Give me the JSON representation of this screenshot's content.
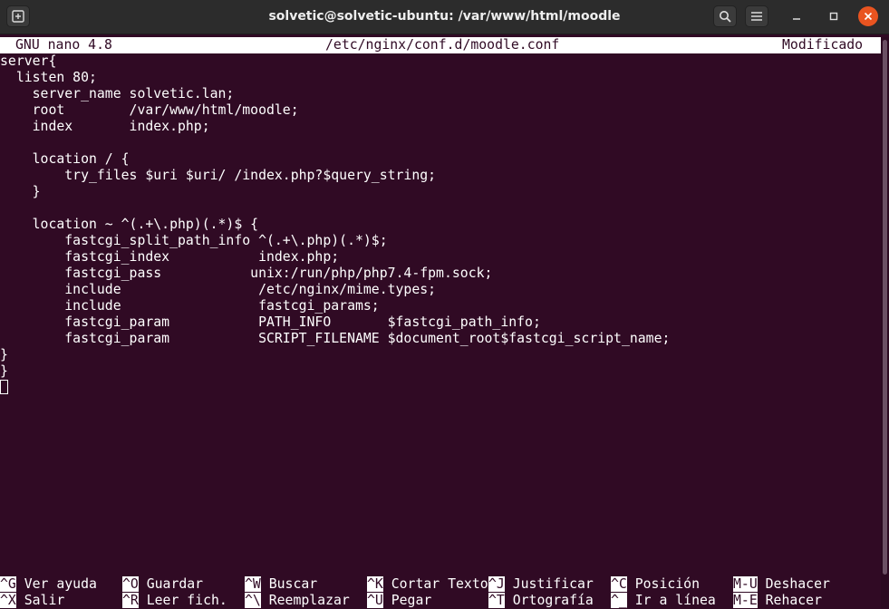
{
  "window": {
    "title": "solvetic@solvetic-ubuntu: /var/www/html/moodle"
  },
  "nano": {
    "version": "GNU nano 4.8",
    "filename": "/etc/nginx/conf.d/moodle.conf",
    "status": "Modificado"
  },
  "editor": {
    "lines": [
      "server{",
      "  listen 80;",
      "    server_name solvetic.lan;",
      "    root        /var/www/html/moodle;",
      "    index       index.php;",
      "",
      "    location / {",
      "        try_files $uri $uri/ /index.php?$query_string;",
      "    }",
      "",
      "    location ~ ^(.+\\.php)(.*)$ {",
      "        fastcgi_split_path_info ^(.+\\.php)(.*)$;",
      "        fastcgi_index           index.php;",
      "        fastcgi_pass           unix:/run/php/php7.4-fpm.sock;",
      "        include                 /etc/nginx/mime.types;",
      "        include                 fastcgi_params;",
      "        fastcgi_param           PATH_INFO       $fastcgi_path_info;",
      "        fastcgi_param           SCRIPT_FILENAME $document_root$fastcgi_script_name;",
      "}",
      "}"
    ]
  },
  "shortcuts": {
    "row1": [
      {
        "key": "^G",
        "label": "Ver ayuda"
      },
      {
        "key": "^O",
        "label": "Guardar"
      },
      {
        "key": "^W",
        "label": "Buscar"
      },
      {
        "key": "^K",
        "label": "Cortar Texto"
      },
      {
        "key": "^J",
        "label": "Justificar"
      },
      {
        "key": "^C",
        "label": "Posición"
      },
      {
        "key": "M-U",
        "label": "Deshacer"
      }
    ],
    "row2": [
      {
        "key": "^X",
        "label": "Salir"
      },
      {
        "key": "^R",
        "label": "Leer fich."
      },
      {
        "key": "^\\",
        "label": "Reemplazar"
      },
      {
        "key": "^U",
        "label": "Pegar"
      },
      {
        "key": "^T",
        "label": "Ortografía"
      },
      {
        "key": "^_",
        "label": "Ir a línea"
      },
      {
        "key": "M-E",
        "label": "Rehacer"
      }
    ]
  },
  "colors": {
    "terminal_bg": "#300a24",
    "titlebar_bg": "#2c2c2c",
    "text": "#ffffff"
  }
}
